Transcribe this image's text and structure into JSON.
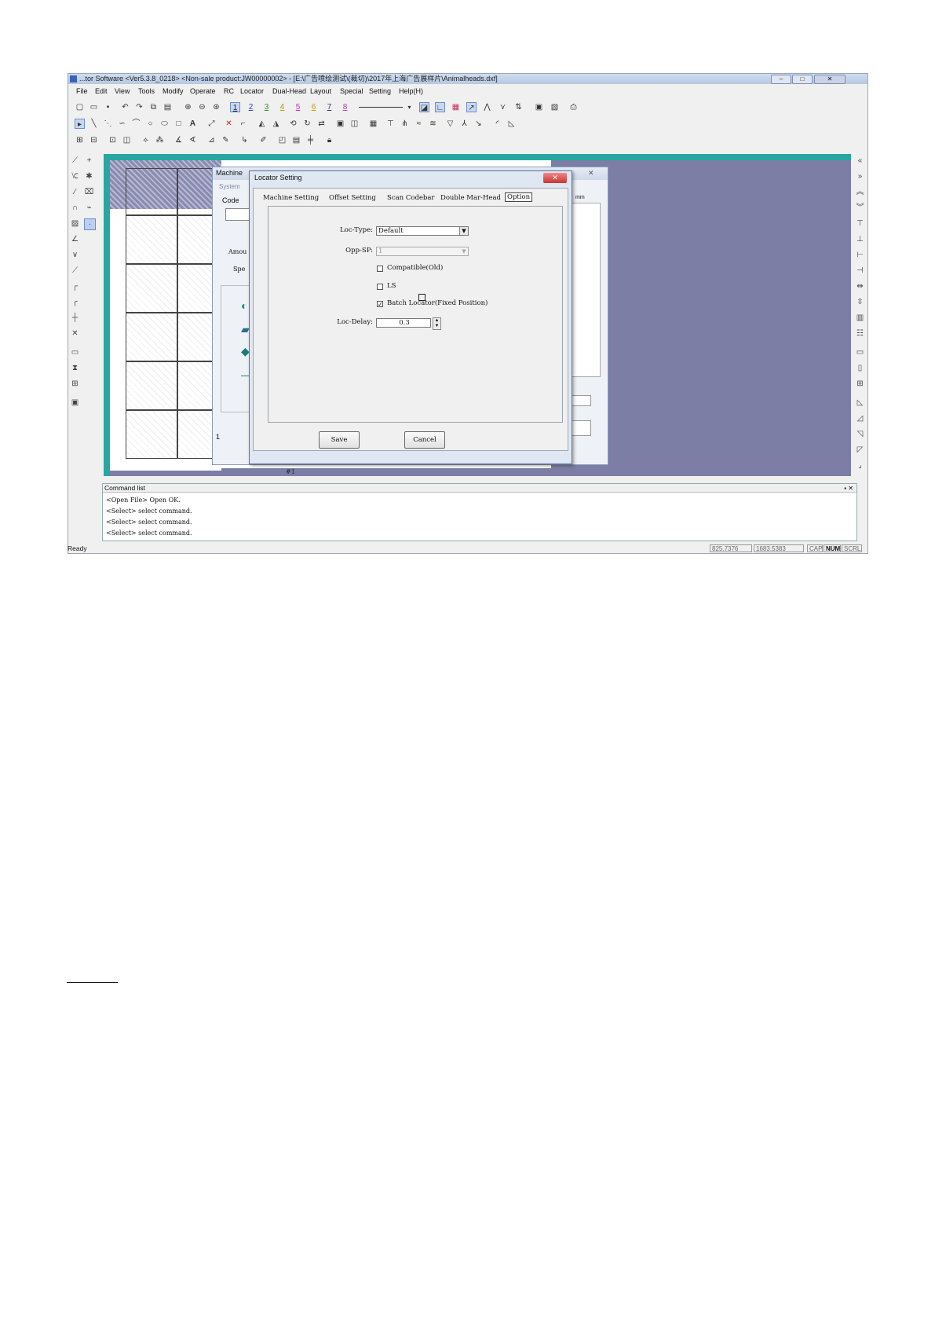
{
  "window": {
    "title": "...tor Software <Ver5.3.8_0218> <Non-sale product:JW00000002> - [E:\\广告喷绘测试\\(裁切)\\2017年上海广告展样片\\Animalheads.dxf]",
    "minimize": "–",
    "maximize": "□",
    "close": "✕"
  },
  "menubar": [
    "File",
    "Edit",
    "View",
    "Tools",
    "Modify",
    "Operate",
    "RC",
    "Locator",
    "Dual-Head",
    "Layout",
    "Special",
    "Setting",
    "Help(H)"
  ],
  "toolbar": {
    "pen_numbers": [
      "1",
      "2",
      "3",
      "4",
      "5",
      "6",
      "7",
      "8"
    ]
  },
  "background_dialog": {
    "title": "Machine",
    "tab": "System",
    "code_label": "Code",
    "amount_label": "Amou",
    "speed_label": "Spe",
    "unit": "mm",
    "footer_value": "1"
  },
  "locator_dialog": {
    "title": "Locator Setting",
    "tabs": [
      "Machine Setting",
      "Offset Setting",
      "Scan Codebar",
      "Double Mar-Head",
      "Option"
    ],
    "selected_tab": "Option",
    "loc_type_label": "Loc-Type:",
    "loc_type_value": "Default",
    "opp_sp_label": "Opp-SP:",
    "opp_sp_value": "1",
    "compatible_label": "Compatible(Old)",
    "compatible_checked": false,
    "ls_label": "LS",
    "ls_checked": false,
    "batch_label": "Batch Locator(Fixed Position)",
    "batch_checked": true,
    "loc_delay_label": "Loc-Delay:",
    "loc_delay_value": "0.3",
    "save_button": "Save",
    "cancel_button": "Cancel"
  },
  "canvas": {
    "sheet_label": "#1"
  },
  "command_list": {
    "title": "Command list",
    "lines": [
      "<Open File> Open OK.",
      "<Select> select command.",
      "<Select> select command.",
      "<Select> select command."
    ]
  },
  "statusbar": {
    "left": "Ready",
    "x": "825.7376",
    "y": "1683.5383",
    "caps": "CAP",
    "num": "NUM",
    "scrl": "SCRL"
  },
  "colors": {
    "canvas": "#7d7ea6",
    "ruler": "#27a7a0",
    "titlebar": "#b6c8e2"
  }
}
